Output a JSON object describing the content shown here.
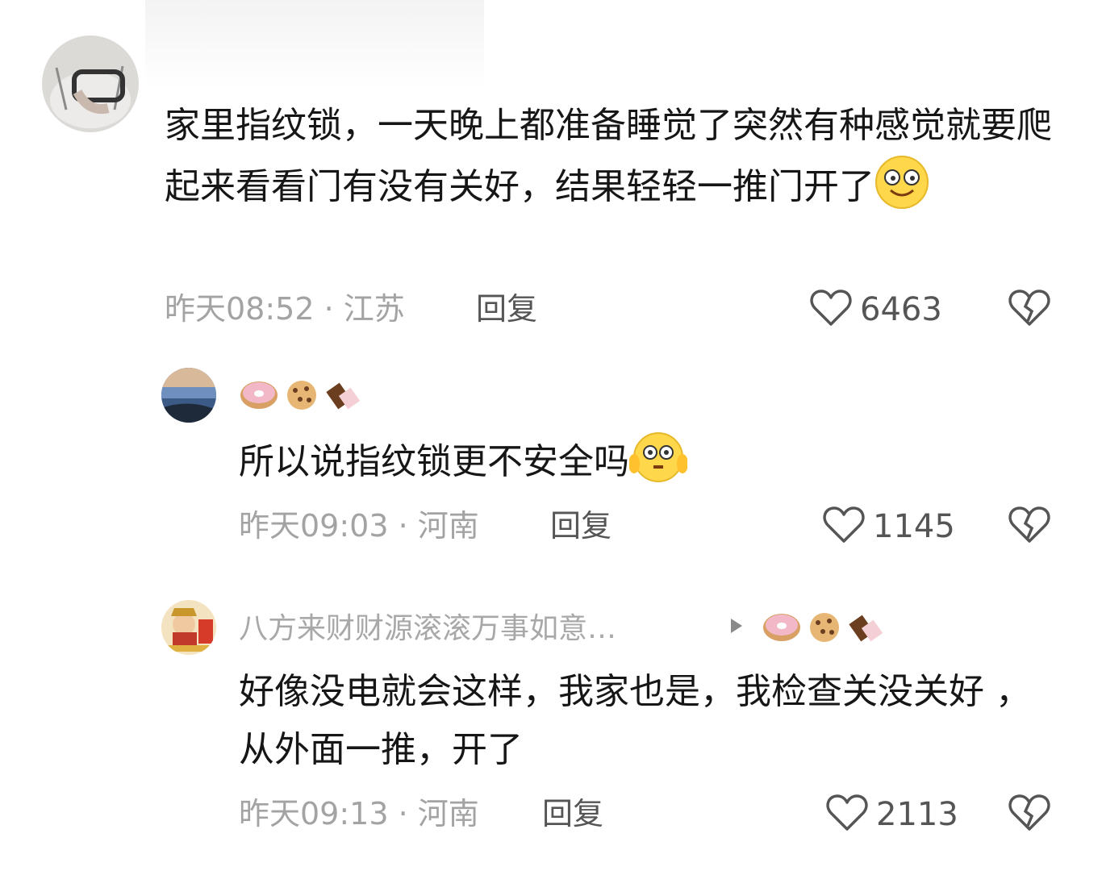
{
  "comments": [
    {
      "text": "家里指纹锁，一天晚上都准备睡觉了突然有种感觉就要爬起来看看门有没有关好，结果轻轻一推门开了",
      "time": "昨天08:52",
      "location": "江苏",
      "reply_label": "回复",
      "likes": "6463",
      "emoji": "smile-emoji"
    },
    {
      "nickname": "",
      "badges": [
        "donut-badge",
        "cookie-badge",
        "chocolate-badge"
      ],
      "text": "所以说指纹锁更不安全吗",
      "time": "昨天09:03",
      "location": "河南",
      "reply_label": "回复",
      "likes": "1145",
      "emoji": "shocked-emoji"
    },
    {
      "nickname": "八方来财财源滚滚万事如意…",
      "badges": [
        "donut-badge",
        "cookie-badge",
        "chocolate-badge"
      ],
      "text": "好像没电就会这样，我家也是，我检查关没关好 ，从外面一推，开了",
      "time": "昨天09:13",
      "location": "河南",
      "reply_label": "回复",
      "likes": "2113"
    }
  ],
  "separator": "·",
  "colors": {
    "text": "#161616",
    "meta": "#a3a3a3",
    "icon": "#555555"
  }
}
